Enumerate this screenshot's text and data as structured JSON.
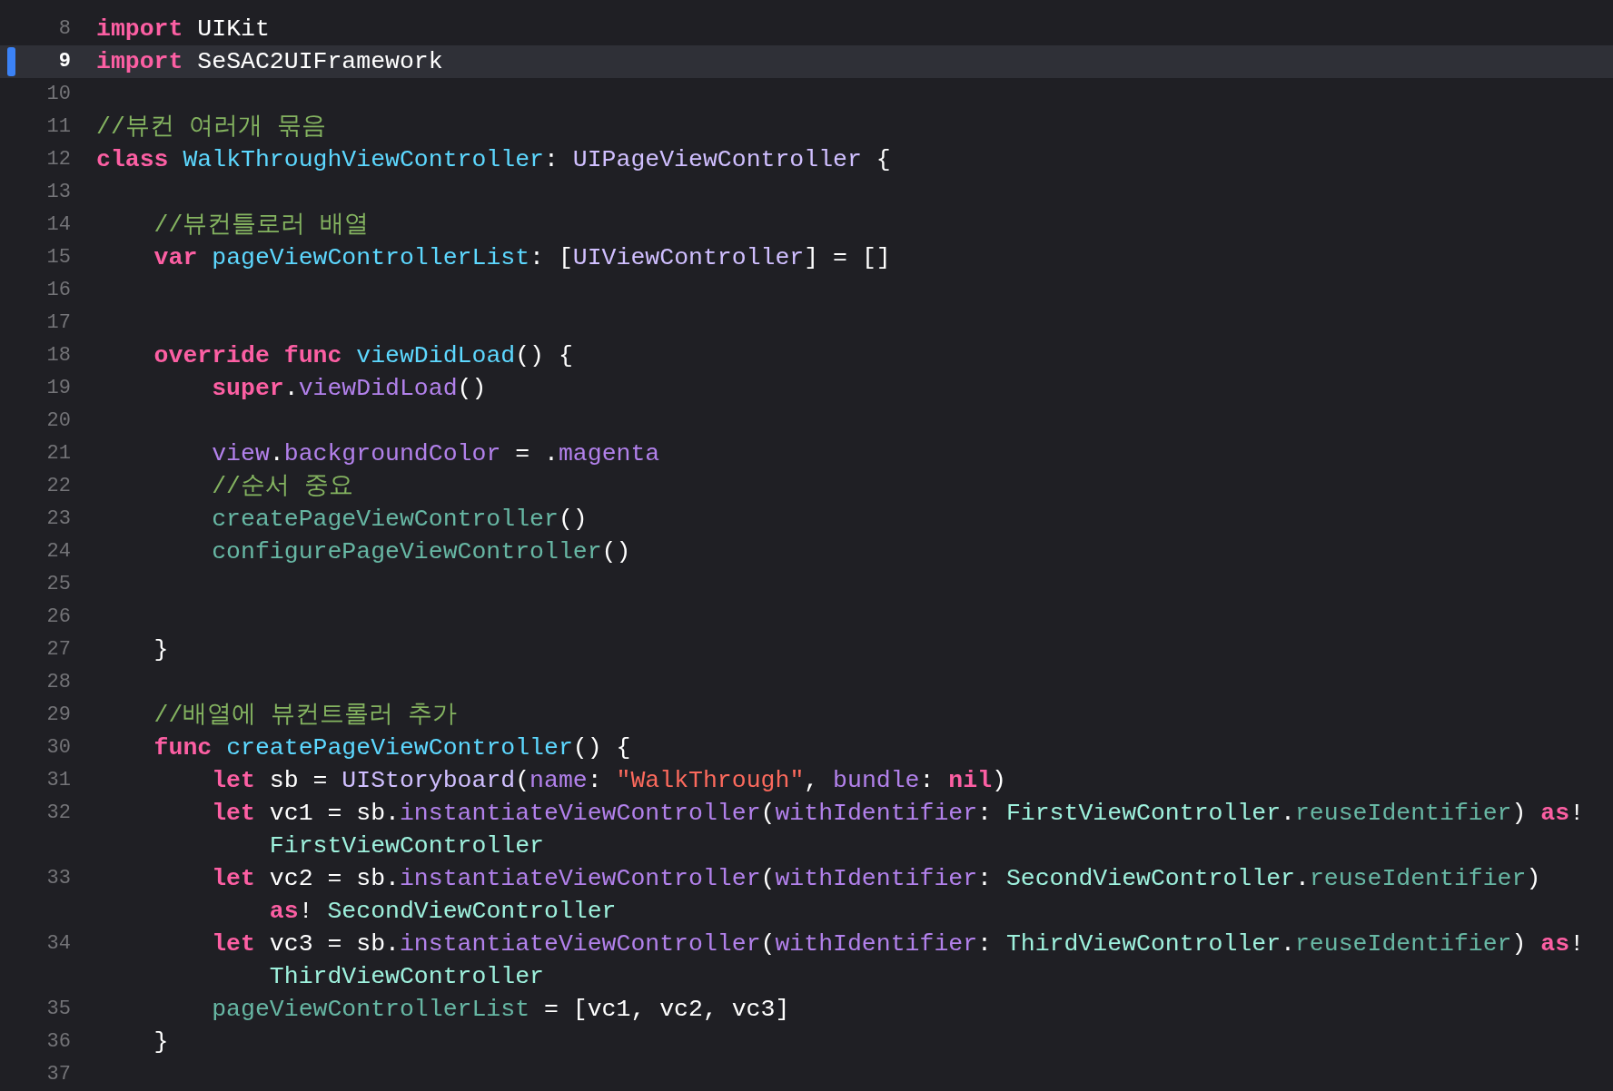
{
  "editor": {
    "lines": [
      {
        "number": "8",
        "selected": false,
        "changed": false,
        "tokens": [
          {
            "kind": "keyword",
            "text": "import"
          },
          {
            "kind": "plain",
            "text": " UIKit"
          }
        ]
      },
      {
        "number": "9",
        "selected": true,
        "changed": true,
        "tokens": [
          {
            "kind": "keyword",
            "text": "import"
          },
          {
            "kind": "plain",
            "text": " SeSAC2UIFramework"
          }
        ]
      },
      {
        "number": "10",
        "selected": false,
        "changed": false
      },
      {
        "number": "11",
        "selected": false,
        "changed": false,
        "tokens": [
          {
            "kind": "comment",
            "text": "//뷰컨 여러개 묶음"
          }
        ]
      },
      {
        "number": "12",
        "selected": false,
        "changed": false,
        "tokens": [
          {
            "kind": "keyword",
            "text": "class"
          },
          {
            "kind": "declaration",
            "text": " WalkThroughViewController"
          },
          {
            "kind": "plain",
            "text": ": "
          },
          {
            "kind": "system_type",
            "text": "UIPageViewController"
          },
          {
            "kind": "plain",
            "text": " {"
          }
        ]
      },
      {
        "number": "13",
        "selected": false,
        "changed": false
      },
      {
        "number": "14",
        "selected": false,
        "changed": false,
        "tokens": [
          {
            "kind": "comment",
            "text": "    //뷰컨틀로러 배열"
          }
        ]
      },
      {
        "number": "15",
        "selected": false,
        "changed": false,
        "tokens": [
          {
            "kind": "keyword",
            "text": "    var"
          },
          {
            "kind": "declaration",
            "text": " pageViewControllerList"
          },
          {
            "kind": "plain",
            "text": ": ["
          },
          {
            "kind": "system_type",
            "text": "UIViewController"
          },
          {
            "kind": "plain",
            "text": "] = []"
          }
        ]
      },
      {
        "number": "16",
        "selected": false,
        "changed": false
      },
      {
        "number": "17",
        "selected": false,
        "changed": false
      },
      {
        "number": "18",
        "selected": false,
        "changed": false,
        "tokens": [
          {
            "kind": "keyword",
            "text": "    override func"
          },
          {
            "kind": "declaration",
            "text": " viewDidLoad"
          },
          {
            "kind": "plain",
            "text": "() {"
          }
        ]
      },
      {
        "number": "19",
        "selected": false,
        "changed": false,
        "tokens": [
          {
            "kind": "keyword",
            "text": "        super"
          },
          {
            "kind": "plain",
            "text": "."
          },
          {
            "kind": "system_member",
            "text": "viewDidLoad"
          },
          {
            "kind": "plain",
            "text": "()"
          }
        ]
      },
      {
        "number": "20",
        "selected": false,
        "changed": false
      },
      {
        "number": "21",
        "selected": false,
        "changed": false,
        "tokens": [
          {
            "kind": "system_member",
            "text": "        view"
          },
          {
            "kind": "plain",
            "text": "."
          },
          {
            "kind": "system_member",
            "text": "backgroundColor"
          },
          {
            "kind": "plain",
            "text": " = ."
          },
          {
            "kind": "system_member",
            "text": "magenta"
          }
        ]
      },
      {
        "number": "22",
        "selected": false,
        "changed": false,
        "tokens": [
          {
            "kind": "comment",
            "text": "        //순서 중요"
          }
        ]
      },
      {
        "number": "23",
        "selected": false,
        "changed": false,
        "tokens": [
          {
            "kind": "project_member",
            "text": "        createPageViewController"
          },
          {
            "kind": "plain",
            "text": "()"
          }
        ]
      },
      {
        "number": "24",
        "selected": false,
        "changed": false,
        "tokens": [
          {
            "kind": "project_member",
            "text": "        configurePageViewController"
          },
          {
            "kind": "plain",
            "text": "()"
          }
        ]
      },
      {
        "number": "25",
        "selected": false,
        "changed": false
      },
      {
        "number": "26",
        "selected": false,
        "changed": false
      },
      {
        "number": "27",
        "selected": false,
        "changed": false,
        "tokens": [
          {
            "kind": "plain",
            "text": "    }"
          }
        ]
      },
      {
        "number": "28",
        "selected": false,
        "changed": false
      },
      {
        "number": "29",
        "selected": false,
        "changed": false,
        "tokens": [
          {
            "kind": "comment",
            "text": "    //배열에 뷰컨트롤러 추가"
          }
        ]
      },
      {
        "number": "30",
        "selected": false,
        "changed": false,
        "tokens": [
          {
            "kind": "keyword",
            "text": "    func"
          },
          {
            "kind": "declaration",
            "text": " createPageViewController"
          },
          {
            "kind": "plain",
            "text": "() {"
          }
        ]
      },
      {
        "number": "31",
        "selected": false,
        "changed": false,
        "tokens": [
          {
            "kind": "keyword",
            "text": "        let"
          },
          {
            "kind": "plain",
            "text": " sb = "
          },
          {
            "kind": "system_type",
            "text": "UIStoryboard"
          },
          {
            "kind": "plain",
            "text": "("
          },
          {
            "kind": "system_member",
            "text": "name"
          },
          {
            "kind": "plain",
            "text": ": "
          },
          {
            "kind": "string",
            "text": "\"WalkThrough\""
          },
          {
            "kind": "plain",
            "text": ", "
          },
          {
            "kind": "system_member",
            "text": "bundle"
          },
          {
            "kind": "plain",
            "text": ": "
          },
          {
            "kind": "keyword",
            "text": "nil"
          },
          {
            "kind": "plain",
            "text": ")"
          }
        ]
      },
      {
        "number": "32",
        "selected": false,
        "changed": false,
        "tokens": [
          {
            "kind": "keyword",
            "text": "        let"
          },
          {
            "kind": "plain",
            "text": " vc1 = sb."
          },
          {
            "kind": "system_member",
            "text": "instantiateViewController"
          },
          {
            "kind": "plain",
            "text": "("
          },
          {
            "kind": "system_member",
            "text": "withIdentifier"
          },
          {
            "kind": "plain",
            "text": ": "
          },
          {
            "kind": "project_type",
            "text": "FirstViewController"
          },
          {
            "kind": "plain",
            "text": "."
          },
          {
            "kind": "project_member",
            "text": "reuseIdentifier"
          },
          {
            "kind": "plain",
            "text": ") "
          },
          {
            "kind": "keyword",
            "text": "as"
          },
          {
            "kind": "plain",
            "text": "!"
          }
        ],
        "wrap": [
          {
            "kind": "project_type",
            "text": "            FirstViewController"
          }
        ]
      },
      {
        "number": "33",
        "selected": false,
        "changed": false,
        "tokens": [
          {
            "kind": "keyword",
            "text": "        let"
          },
          {
            "kind": "plain",
            "text": " vc2 = sb."
          },
          {
            "kind": "system_member",
            "text": "instantiateViewController"
          },
          {
            "kind": "plain",
            "text": "("
          },
          {
            "kind": "system_member",
            "text": "withIdentifier"
          },
          {
            "kind": "plain",
            "text": ": "
          },
          {
            "kind": "project_type",
            "text": "SecondViewController"
          },
          {
            "kind": "plain",
            "text": "."
          },
          {
            "kind": "project_member",
            "text": "reuseIdentifier"
          },
          {
            "kind": "plain",
            "text": ")"
          }
        ],
        "wrap": [
          {
            "kind": "keyword",
            "text": "            as"
          },
          {
            "kind": "plain",
            "text": "! "
          },
          {
            "kind": "project_type",
            "text": "SecondViewController"
          }
        ]
      },
      {
        "number": "34",
        "selected": false,
        "changed": false,
        "tokens": [
          {
            "kind": "keyword",
            "text": "        let"
          },
          {
            "kind": "plain",
            "text": " vc3 = sb."
          },
          {
            "kind": "system_member",
            "text": "instantiateViewController"
          },
          {
            "kind": "plain",
            "text": "("
          },
          {
            "kind": "system_member",
            "text": "withIdentifier"
          },
          {
            "kind": "plain",
            "text": ": "
          },
          {
            "kind": "project_type",
            "text": "ThirdViewController"
          },
          {
            "kind": "plain",
            "text": "."
          },
          {
            "kind": "project_member",
            "text": "reuseIdentifier"
          },
          {
            "kind": "plain",
            "text": ") "
          },
          {
            "kind": "keyword",
            "text": "as"
          },
          {
            "kind": "plain",
            "text": "!"
          }
        ],
        "wrap": [
          {
            "kind": "project_type",
            "text": "            ThirdViewController"
          }
        ]
      },
      {
        "number": "35",
        "selected": false,
        "changed": false,
        "tokens": [
          {
            "kind": "project_member",
            "text": "        pageViewControllerList"
          },
          {
            "kind": "plain",
            "text": " = [vc1, vc2, vc3]"
          }
        ]
      },
      {
        "number": "36",
        "selected": false,
        "changed": false,
        "tokens": [
          {
            "kind": "plain",
            "text": "    }"
          }
        ]
      },
      {
        "number": "37",
        "selected": false,
        "changed": false
      }
    ]
  }
}
